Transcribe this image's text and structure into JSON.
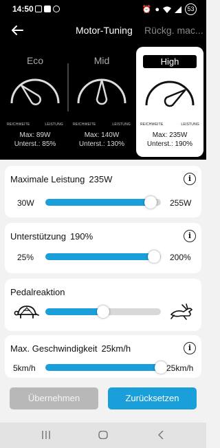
{
  "status": {
    "time": "14:50",
    "battery": "53"
  },
  "header": {
    "title": "Motor-Tuning",
    "next_tab": "Rückg. mac..."
  },
  "modes": [
    {
      "name": "Eco",
      "range_label": "REICHWEITE",
      "power_label": "LEISTUNG",
      "max": "Max: 89W",
      "support": "Unterst.: 85%",
      "needle": 0.25
    },
    {
      "name": "Mid",
      "range_label": "REICHWEITE",
      "power_label": "LEISTUNG",
      "max": "Max: 140W",
      "support": "Unterst.: 130%",
      "needle": 0.5
    },
    {
      "name": "High",
      "range_label": "REICHWEITE",
      "power_label": "LEISTUNG",
      "max": "Max: 235W",
      "support": "Unterst.: 190%",
      "needle": 0.8,
      "selected": true
    }
  ],
  "cards": {
    "max_power": {
      "title": "Maximale Leistung",
      "value": "235W",
      "min": "30W",
      "max": "255W",
      "fraction": 0.91
    },
    "support": {
      "title": "Unterstützung",
      "value": "190%",
      "min": "25%",
      "max": "200%",
      "fraction": 0.94
    },
    "pedal": {
      "title": "Pedalreaktion",
      "fraction": 0.5,
      "slow_icon": "turtle-icon",
      "fast_icon": "rabbit-icon"
    },
    "speed": {
      "title": "Max. Geschwindigkeit",
      "value": "25km/h",
      "min": "5km/h",
      "max": "25km/h",
      "fraction": 1.0
    }
  },
  "buttons": {
    "apply": "Übernehmen",
    "reset": "Zurücksetzen"
  },
  "colors": {
    "accent": "#1a9fdb",
    "track": "#d8d8d8",
    "disabled": "#b8b8b8"
  }
}
